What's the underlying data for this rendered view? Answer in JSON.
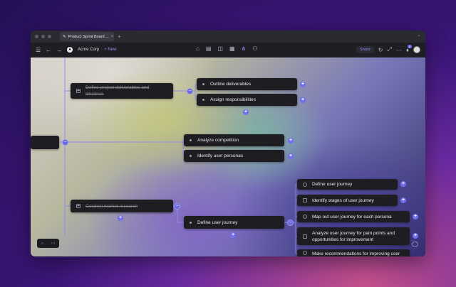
{
  "window": {
    "tab_title": "Product Sprint Board ...",
    "tab_close": "×",
    "new_tab": "+",
    "window_menu": "⌄"
  },
  "toolbar": {
    "menu_icon": "☰",
    "back_icon": "←",
    "forward_icon": "→",
    "workspace_logo": "A",
    "workspace_name": "Acme Corp",
    "new_label": "+ New",
    "center_icons": [
      "⌂",
      "▤",
      "◫",
      "▦",
      "⋔",
      "⚇"
    ],
    "share_label": "Share",
    "notification_count": "2"
  },
  "mindmap": {
    "nodes": {
      "define_main_deliverables": "Define project deliverables and timelines",
      "outline_deliverables": "Outline deliverables",
      "assign_responsibilities": "Assign responsibilities",
      "analyze_competition": "Analyze competition",
      "identify_personas": "Identify user personas",
      "conduct_research": "Conduct market research",
      "define_user_journey": "Define user journey",
      "j_define": "Define user journey",
      "j_identify_stages": "Identify stages of user journey",
      "j_map_out": "Map out user journey for each persona",
      "j_analyze_pain": "Analyze user journey for pain points and opportunities for improvement",
      "j_recommendations": "Make recommendations for improving user journey"
    },
    "plus": "+",
    "minus": "−",
    "check": "✓"
  },
  "controls": {
    "zoom_out": "−",
    "zoom_menu": "⋯",
    "chat_icon": "◯"
  }
}
